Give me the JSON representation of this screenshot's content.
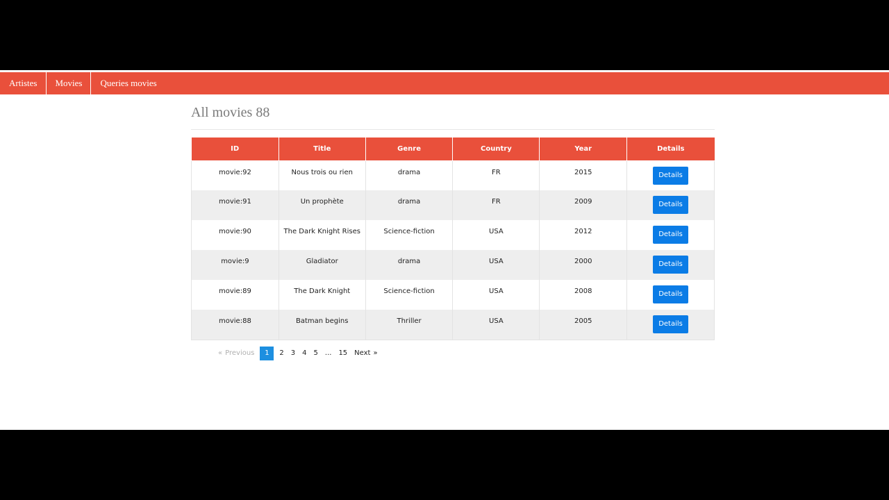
{
  "nav": {
    "items": [
      {
        "label": "Artistes"
      },
      {
        "label": "Movies"
      },
      {
        "label": "Queries movies"
      }
    ]
  },
  "page": {
    "title": "All movies 88"
  },
  "table": {
    "headers": [
      "ID",
      "Title",
      "Genre",
      "Country",
      "Year",
      "Details"
    ],
    "rows": [
      {
        "id": "movie:92",
        "title": "Nous trois ou rien",
        "genre": "drama",
        "country": "FR",
        "year": "2015",
        "details": "Details"
      },
      {
        "id": "movie:91",
        "title": "Un prophète",
        "genre": "drama",
        "country": "FR",
        "year": "2009",
        "details": "Details"
      },
      {
        "id": "movie:90",
        "title": "The Dark Knight Rises",
        "genre": "Science-fiction",
        "country": "USA",
        "year": "2012",
        "details": "Details"
      },
      {
        "id": "movie:9",
        "title": "Gladiator",
        "genre": "drama",
        "country": "USA",
        "year": "2000",
        "details": "Details"
      },
      {
        "id": "movie:89",
        "title": "The Dark Knight",
        "genre": "Science-fiction",
        "country": "USA",
        "year": "2008",
        "details": "Details"
      },
      {
        "id": "movie:88",
        "title": "Batman begins",
        "genre": "Thriller",
        "country": "USA",
        "year": "2005",
        "details": "Details"
      }
    ]
  },
  "pagination": {
    "prev_arrow": "«",
    "prev_label": "Previous",
    "pages": [
      "1",
      "2",
      "3",
      "4",
      "5",
      "...",
      "15"
    ],
    "current": "1",
    "next_label": "Next",
    "next_arrow": "»"
  },
  "colors": {
    "accent": "#e9503b",
    "button": "#0b7ce6",
    "current_page": "#1d8fe0"
  }
}
